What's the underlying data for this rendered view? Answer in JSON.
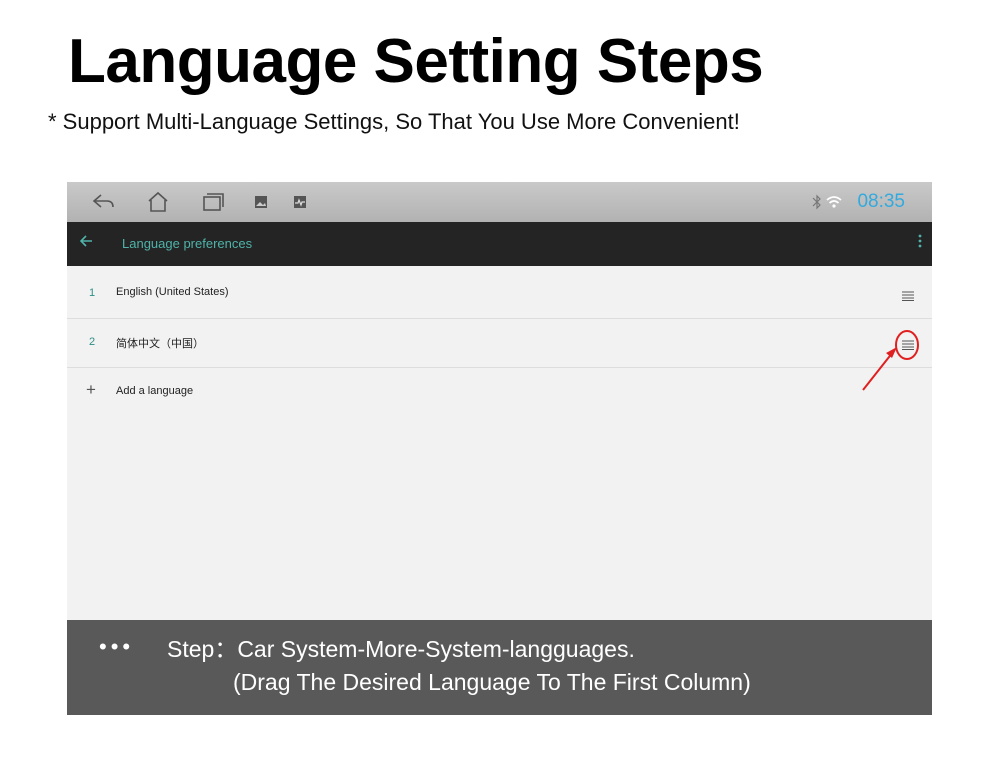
{
  "header": {
    "title": "Language Setting Steps",
    "subtitle": "* Support Multi-Language Settings, So That You Use More Convenient!"
  },
  "statusbar": {
    "nav_icons": [
      "back-arrow-icon",
      "home-icon",
      "recent-apps-icon",
      "gallery-icon",
      "screenshot-icon"
    ],
    "status_icons": [
      "bluetooth-icon",
      "wifi-icon"
    ],
    "time": "08:35",
    "clock_color": "#33aadd"
  },
  "appbar": {
    "title": "Language preferences",
    "accent": "#4fb3a9",
    "back_icon": "arrow-left-icon",
    "menu_icon": "more-vert-icon"
  },
  "languages": [
    {
      "index": "1",
      "name": "English (United States)"
    },
    {
      "index": "2",
      "name": "简体中文（中国）"
    }
  ],
  "add_language": {
    "label": "Add a language",
    "icon": "plus-icon"
  },
  "annotation": {
    "color": "#e02020",
    "target": "drag-handle-icon"
  },
  "step": {
    "dots": "•••",
    "line1": "Step：Car System-More-System-langguages.",
    "line2": "(Drag The Desired Language To The First Column)"
  }
}
